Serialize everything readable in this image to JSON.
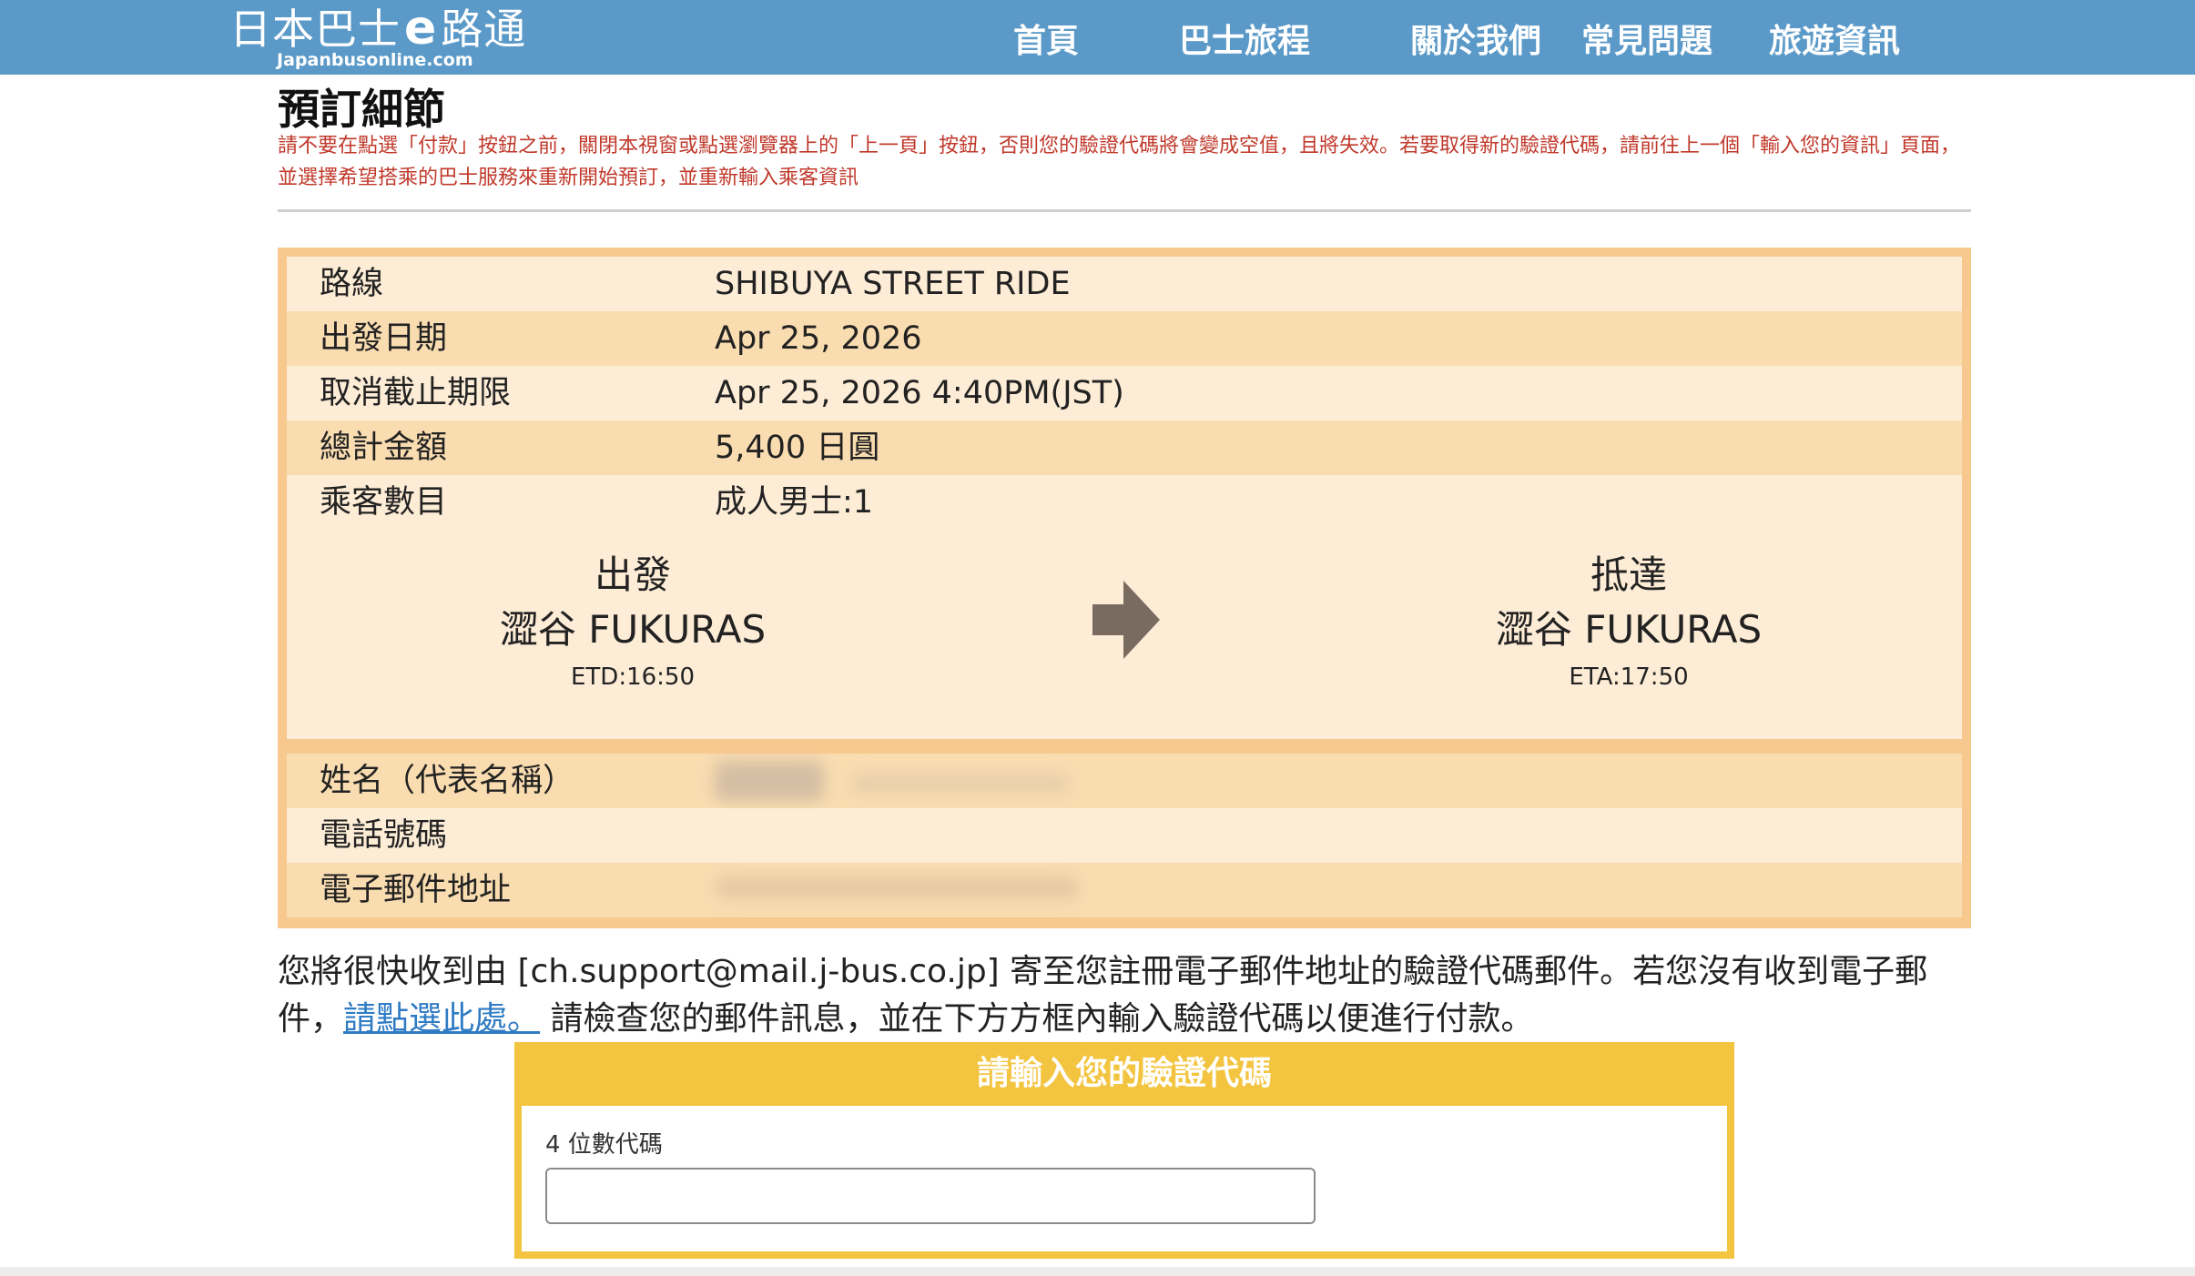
{
  "header": {
    "logo_text_left": "日本巴士",
    "logo_e": "e",
    "logo_text_right": "路通",
    "logo_sub": "Japanbusonline.com",
    "nav": [
      "首頁",
      "巴士旅程",
      "關於我們",
      "常見問題",
      "旅遊資訊"
    ]
  },
  "page": {
    "title": "預訂細節",
    "warning": "請不要在點選「付款」按鈕之前，關閉本視窗或點選瀏覽器上的「上一頁」按鈕，否則您的驗證代碼將會變成空值，且將失效。若要取得新的驗證代碼，請前往上一個「輸入您的資訊」頁面，並選擇希望搭乘的巴士服務來重新開始預訂，並重新輸入乘客資訊"
  },
  "booking": {
    "rows": [
      {
        "label": "路線",
        "value": "SHIBUYA STREET RIDE"
      },
      {
        "label": "出發日期",
        "value": "Apr 25, 2026"
      },
      {
        "label": "取消截止期限",
        "value": "Apr 25, 2026 4:40PM(JST)"
      },
      {
        "label": "總計金額",
        "value": "5,400 日圓"
      },
      {
        "label": "乘客數目",
        "value": "成人男士:1"
      }
    ],
    "departure": {
      "heading": "出發",
      "stop": "澀谷 FUKURAS",
      "time": "ETD:16:50"
    },
    "arrival": {
      "heading": "抵達",
      "stop": "澀谷 FUKURAS",
      "time": "ETA:17:50"
    },
    "contact_rows": [
      {
        "label": "姓名（代表名稱）"
      },
      {
        "label": "電話號碼"
      },
      {
        "label": "電子郵件地址"
      }
    ]
  },
  "notice": {
    "text_before": "您將很快收到由 [ch.support@mail.j-bus.co.jp] 寄至您註冊電子郵件地址的驗證代碼郵件。若您沒有收到電子郵件，",
    "link": "請點選此處。",
    "text_after": " 請檢查您的郵件訊息，並在下方方框內輸入驗證代碼以便進行付款。"
  },
  "verification": {
    "header": "請輸入您的驗證代碼",
    "label": "4 位數代碼",
    "value": ""
  },
  "colors": {
    "topbar": "#5b9ac8",
    "panel": "#f7c98f",
    "warning": "#c0392b",
    "code_header": "#f3c43f",
    "link": "#2f7bc4"
  }
}
